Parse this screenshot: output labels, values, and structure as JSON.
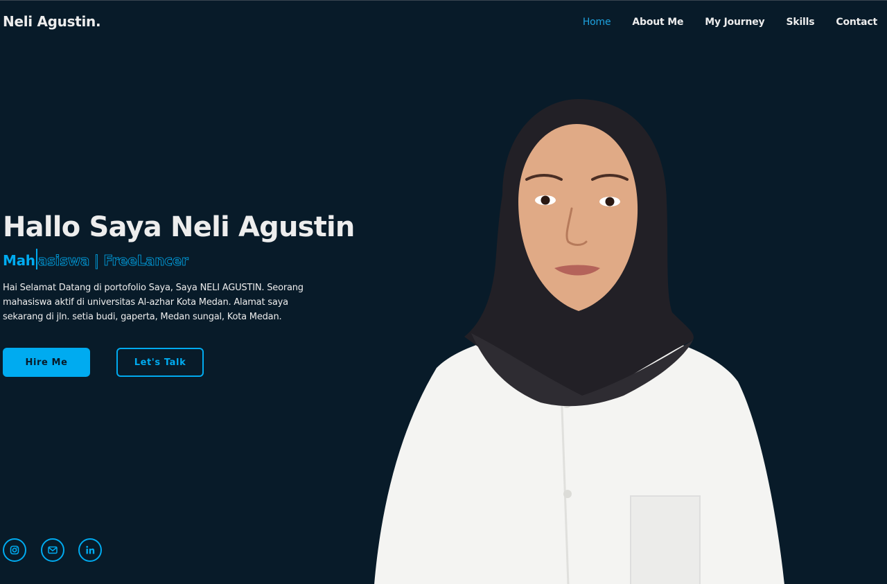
{
  "header": {
    "logo": "Neli Agustin.",
    "nav": [
      {
        "label": "Home",
        "active": true
      },
      {
        "label": "About Me",
        "active": false
      },
      {
        "label": "My Journey",
        "active": false
      },
      {
        "label": "Skills",
        "active": false
      },
      {
        "label": "Contact",
        "active": false
      }
    ]
  },
  "hero": {
    "title": "Hallo Saya Neli Agustin",
    "subtitle_typed": "Mah",
    "subtitle_rest": "asiswa | FreeLancer",
    "description": "Hai Selamat Datang di portofolio Saya, Saya NELI AGUSTIN. Seorang mahasiswa aktif di universitas Al-azhar Kota Medan. Alamat saya sekarang di jln. setia budi, gaperta, Medan sungal, Kota Medan.",
    "buttons": {
      "hire": "Hire Me",
      "talk": "Let's Talk"
    }
  },
  "socials": [
    {
      "icon": "instagram-icon"
    },
    {
      "icon": "mail-icon"
    },
    {
      "icon": "linkedin-icon"
    }
  ],
  "colors": {
    "background": "#081b29",
    "accent": "#00abf0",
    "text": "#ededed"
  }
}
